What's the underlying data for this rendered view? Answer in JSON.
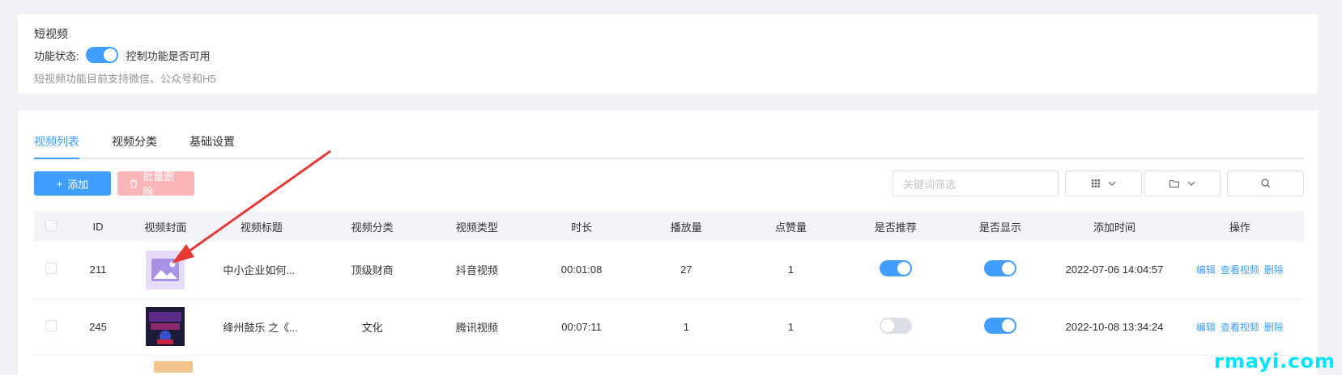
{
  "feature": {
    "title": "短视频",
    "status_label": "功能状态:",
    "status_hint": "控制功能是否可用",
    "status_on": true,
    "description": "短视频功能目前支持微信、公众号和H5"
  },
  "tabs": [
    {
      "label": "视频列表",
      "active": true
    },
    {
      "label": "视频分类",
      "active": false
    },
    {
      "label": "基础设置",
      "active": false
    }
  ],
  "toolbar": {
    "add_label": "添加",
    "batch_delete_label": "批量删除",
    "search_placeholder": "关键词筛选"
  },
  "table": {
    "headers": [
      "",
      "ID",
      "视频封面",
      "视频标题",
      "视频分类",
      "视频类型",
      "时长",
      "播放量",
      "点赞量",
      "是否推荐",
      "是否显示",
      "添加时间",
      "操作"
    ],
    "rows": [
      {
        "id": "211",
        "cover": "placeholder-image",
        "title": "中小企业如何...",
        "category": "顶级财商",
        "type": "抖音视频",
        "duration": "00:01:08",
        "plays": "27",
        "likes": "1",
        "recommend": true,
        "visible": true,
        "added": "2022-07-06 14:04:57"
      },
      {
        "id": "245",
        "cover": "dark-poster",
        "title": "绛州鼓乐 之《...",
        "category": "文化",
        "type": "腾讯视频",
        "duration": "00:07:11",
        "plays": "1",
        "likes": "1",
        "recommend": false,
        "visible": true,
        "added": "2022-10-08 13:34:24"
      }
    ],
    "ops": {
      "edit": "编辑",
      "view": "查看视频",
      "delete": "删除"
    }
  },
  "annotation": {
    "color": "#e53935"
  },
  "watermark": "rmayi.com",
  "colors": {
    "primary": "#409eff",
    "danger_light": "#fab6b6",
    "switch_off": "#dcdfe6"
  }
}
